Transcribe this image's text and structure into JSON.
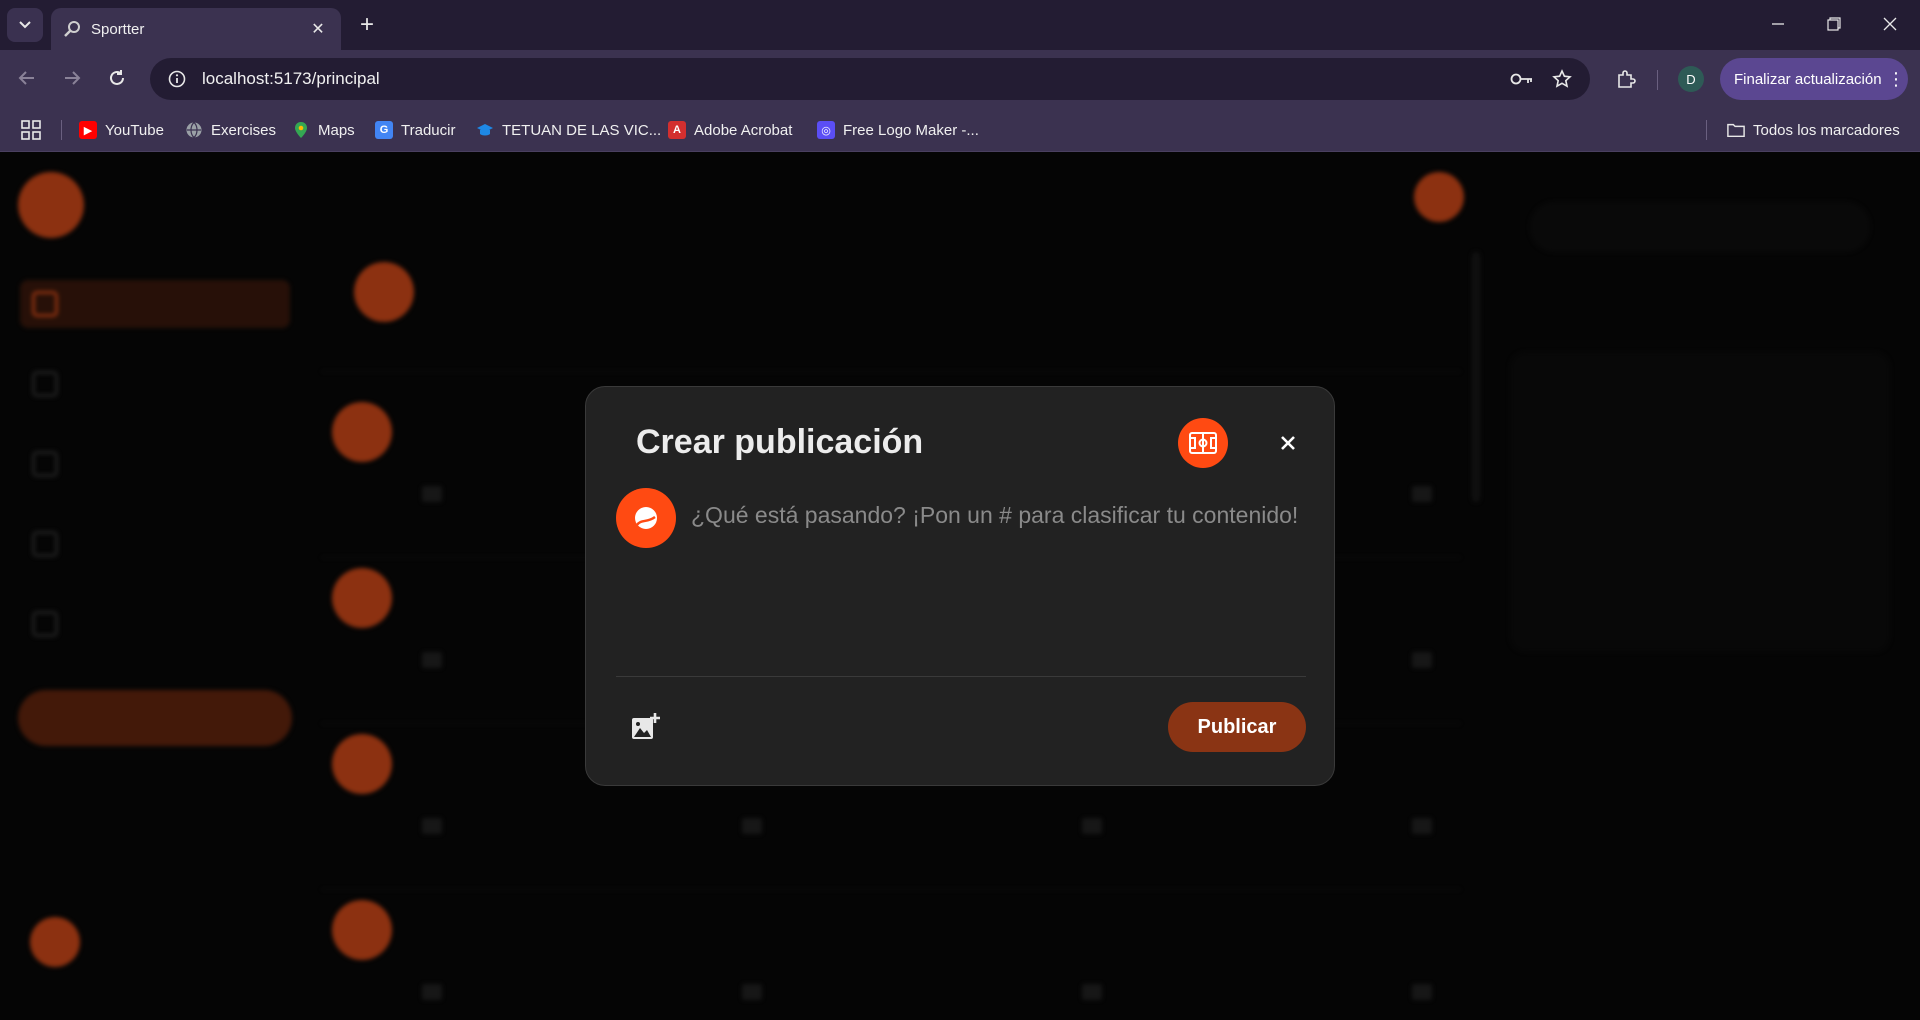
{
  "browser": {
    "tab_title": "Sportter",
    "url": "localhost:5173/principal",
    "update_button": "Finalizar actualización",
    "profile_initial": "D",
    "bookmarks": [
      {
        "label": "YouTube",
        "icon": "youtube-icon",
        "color": "#ff0000"
      },
      {
        "label": "Exercises",
        "icon": "globe-icon",
        "color": "#9aa0a6"
      },
      {
        "label": "Maps",
        "icon": "maps-icon",
        "color": "#34a853"
      },
      {
        "label": "Traducir",
        "icon": "translate-icon",
        "color": "#4285f4"
      },
      {
        "label": "TETUAN DE LAS VIC...",
        "icon": "school-icon",
        "color": "#1e88e5"
      },
      {
        "label": "Adobe Acrobat",
        "icon": "acrobat-icon",
        "color": "#d32f2f"
      },
      {
        "label": "Free Logo Maker -...",
        "icon": "logo-maker-icon",
        "color": "#5b4ef5"
      }
    ],
    "all_bookmarks": "Todos los marcadores"
  },
  "modal": {
    "title": "Crear publicación",
    "placeholder": "¿Qué está pasando? ¡Pon un # para clasificar tu contenido!",
    "publish_label": "Publicar"
  },
  "colors": {
    "accent": "#ff4a12",
    "publish": "#8a3414",
    "modal_bg": "#222222"
  }
}
